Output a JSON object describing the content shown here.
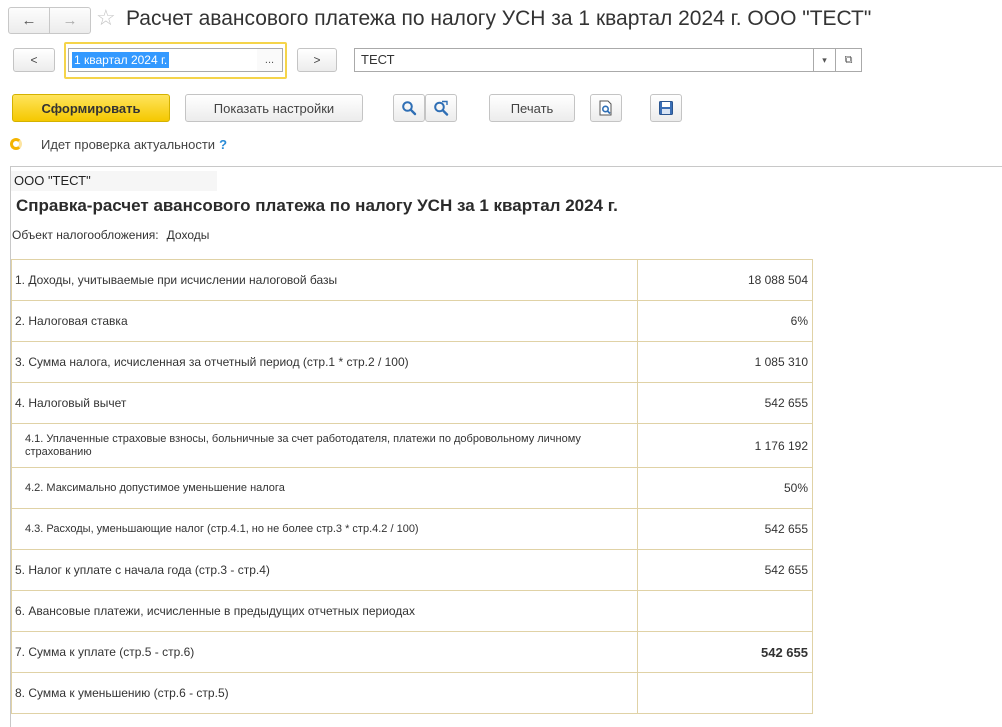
{
  "window": {
    "title": "Расчет авансового платежа по налогу УСН за 1 квартал 2024 г. ООО \"ТЕСТ\"",
    "back_icon": "arrow-left",
    "forward_icon": "arrow-right",
    "favorite_icon": "star"
  },
  "period": {
    "prev_label": "<",
    "value": "1 квартал 2024 г.",
    "select_label": "...",
    "next_label": ">"
  },
  "organization": {
    "value": "ТЕСТ",
    "dropdown_label": "▾",
    "open_label": "⧉"
  },
  "toolbar": {
    "generate_label": "Сформировать",
    "settings_label": "Показать настройки",
    "print_label": "Печать",
    "search_icon": "search",
    "search_next_icon": "search-next",
    "preview_icon": "preview",
    "save_icon": "floppy-disk"
  },
  "status": {
    "text": "Идет проверка актуальности",
    "help": "?"
  },
  "report": {
    "org": "ООО \"ТЕСТ\"",
    "title": "Справка-расчет авансового платежа по налогу УСН за 1 квартал 2024 г.",
    "object_label": "Объект налогообложения:",
    "object_value": "Доходы",
    "rows": [
      {
        "label": "1. Доходы, учитываемые при исчислении налоговой базы",
        "value": "18 088 504"
      },
      {
        "label": "2. Налоговая ставка",
        "value": "6%"
      },
      {
        "label": "3. Сумма налога, исчисленная за отчетный период (стр.1 * стр.2 / 100)",
        "value": "1 085 310"
      },
      {
        "label": "4. Налоговый вычет",
        "value": "542 655"
      },
      {
        "label": "4.1. Уплаченные страховые взносы, больничные за счет работодателя, платежи по добровольному личному страхованию",
        "value": "1 176 192"
      },
      {
        "label": "4.2. Максимально допустимое уменьшение налога",
        "value": "50%"
      },
      {
        "label": "4.3. Расходы, уменьшающие налог (стр.4.1, но не более стр.3 * стр.4.2 / 100)",
        "value": "542 655"
      },
      {
        "label": "5. Налог к уплате с начала года (стр.3 - стр.4)",
        "value": "542 655"
      },
      {
        "label": "6. Авансовые платежи, исчисленные в предыдущих отчетных периодах",
        "value": ""
      },
      {
        "label": "7. Сумма к уплате (стр.5 - стр.6)",
        "value": "542 655"
      },
      {
        "label": "8. Сумма к уменьшению (стр.6 - стр.5)",
        "value": ""
      }
    ]
  },
  "colors": {
    "accent": "#f5c800",
    "focus_border": "#f5d44a",
    "selection": "#3399ff",
    "table_border": "#e0d2a6"
  }
}
